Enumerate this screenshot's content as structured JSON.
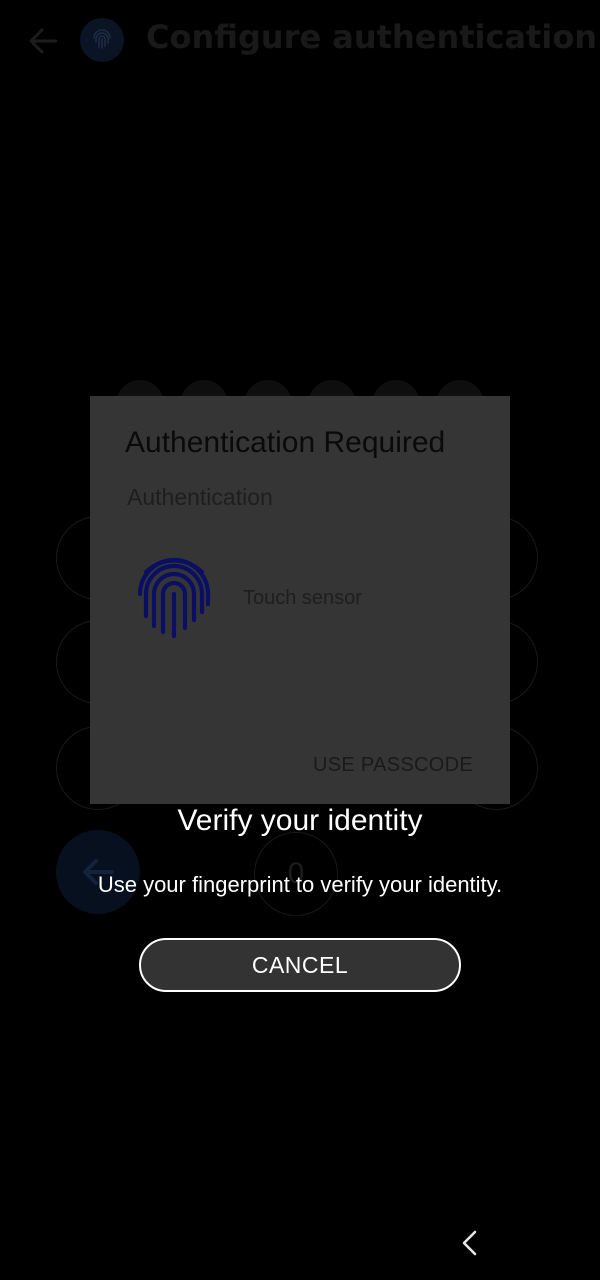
{
  "app": {
    "header": {
      "title": "Configure authentication",
      "back_icon": "arrow-left-icon",
      "logo_icon": "fingerprint-icon"
    },
    "keypad": {
      "zero_label": "0",
      "backspace_icon": "arrow-left-icon"
    }
  },
  "auth_dialog": {
    "title": "Authentication Required",
    "subtitle": "Authentication",
    "sensor_icon": "fingerprint-icon",
    "sensor_label": "Touch sensor",
    "passcode_button": "USE PASSCODE",
    "icon_color": "#0b0f63"
  },
  "verify_prompt": {
    "title": "Verify your identity",
    "description": "Use your fingerprint to verify your identity.",
    "cancel_button": "CANCEL"
  },
  "system_nav": {
    "back_icon": "chevron-left-icon"
  }
}
